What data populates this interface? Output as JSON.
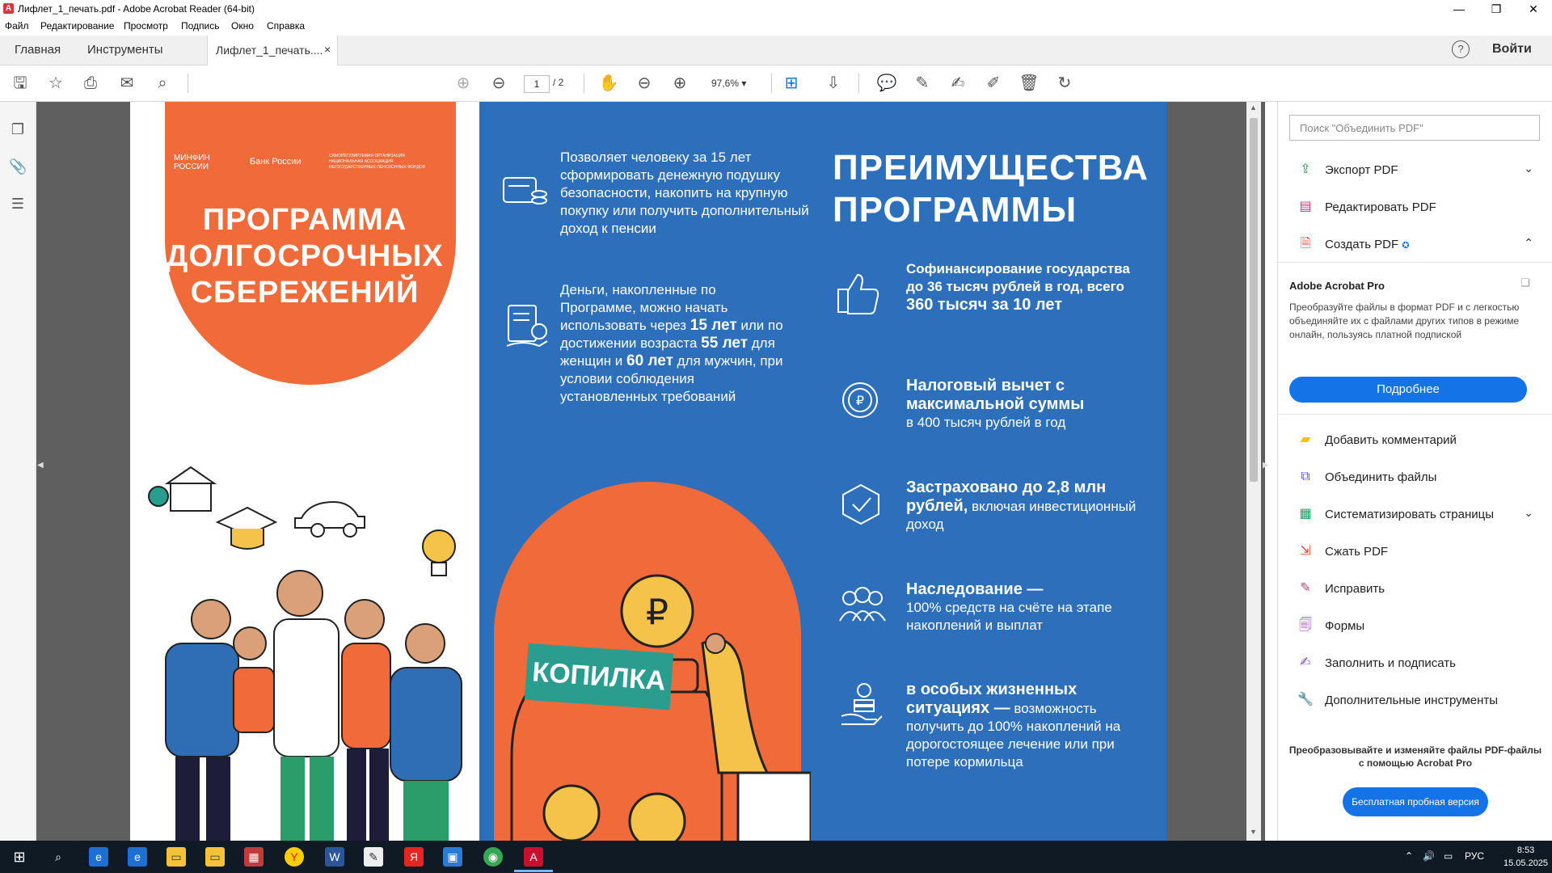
{
  "window": {
    "title": "Лифлет_1_печать.pdf - Adobe Acrobat Reader (64-bit)"
  },
  "menu": [
    "Файл",
    "Редактирование",
    "Просмотр",
    "Подпись",
    "Окно",
    "Справка"
  ],
  "tabs": {
    "home": "Главная",
    "tools": "Инструменты",
    "doc": "Лифлет_1_печать....",
    "close": "×",
    "login": "Войти",
    "help": "?"
  },
  "toolbar": {
    "page_current": "1",
    "page_total": "/ 2",
    "zoom": "97,6%"
  },
  "leaflet": {
    "logos": {
      "minfin": "МИНФИН РОССИИ",
      "cbr": "Банк России",
      "npf": "САМОРЕГУЛИРУЕМАЯ ОРГАНИЗАЦИЯ НАЦИОНАЛЬНАЯ АССОЦИАЦИЯ НЕГОСУДАРСТВЕННЫХ ПЕНСИОННЫХ ФОНДОВ"
    },
    "title_lines": [
      "ПРОГРАММА",
      "ДОЛГОСРОЧНЫХ",
      "СБЕРЕЖЕНИЙ"
    ],
    "block1": "Позволяет человеку за 15 лет сформировать денежную подушку безопасности, накопить на крупную покупку или получить дополнительный доход к пенсии",
    "block2": {
      "p1": "Деньги, накопленные по Программе, можно начать использовать через ",
      "b1": "15 лет",
      "p2": " или по достижении возраста ",
      "b2": "55 лет",
      "p3": " для женщин и ",
      "b3": "60 лет",
      "p4": " для мужчин, при условии соблюдения установленных требований"
    },
    "jar_label": "КОПИЛКА",
    "adv_title_lines": [
      "ПРЕИМУЩЕСТВА",
      "ПРОГРАММЫ"
    ],
    "adv1": {
      "t1": "Софинансирование государства до 36 тысяч рублей в год, всего ",
      "b": "360 тысяч за 10 лет"
    },
    "adv2": {
      "b": "Налоговый вычет с максимальной суммы",
      "t": "в 400 тысяч рублей в год"
    },
    "adv3": {
      "b": "Застраховано до 2,8 млн рублей,",
      "t": " включая инвестиционный доход"
    },
    "adv4": {
      "b": "Наследование —",
      "t": "100% средств на счёте на этапе накоплений и выплат"
    },
    "adv5": {
      "b": "в особых жизненных ситуациях —",
      "t": " возможность получить до 100% накоплений на дорогостоящее лечение или при потере кормильца"
    }
  },
  "right_panel": {
    "search_placeholder": "Поиск \"Объединить PDF\"",
    "items_top": [
      {
        "label": "Экспорт PDF",
        "icon": "export-pdf-icon",
        "color": "#1fa25a"
      },
      {
        "label": "Редактировать PDF",
        "icon": "edit-pdf-icon",
        "color": "#d9367a"
      },
      {
        "label": "Создать PDF",
        "icon": "create-pdf-icon",
        "color": "#e4443a"
      }
    ],
    "promo_title": "Adobe Acrobat Pro",
    "promo_desc": "Преобразуйте файлы в формат PDF и с легкостью объединяйте их с файлами других типов в режиме онлайн, пользуясь платной подпиской",
    "promo_button": "Подробнее",
    "items_bottom": [
      {
        "label": "Добавить комментарий",
        "color": "#f4c20d"
      },
      {
        "label": "Объединить файлы",
        "color": "#5a4fcf"
      },
      {
        "label": "Систематизировать страницы",
        "color": "#1fa25a"
      },
      {
        "label": "Сжать PDF",
        "color": "#e4443a"
      },
      {
        "label": "Исправить",
        "color": "#d9367a"
      },
      {
        "label": "Формы",
        "color": "#9b3bc4"
      },
      {
        "label": "Заполнить и подписать",
        "color": "#7a4fb5"
      },
      {
        "label": "Дополнительные инструменты",
        "color": "#444444"
      }
    ],
    "bottom_promo_lines": [
      "Преобразовывайте и изменяйте файлы PDF-файлы",
      "с помощью Acrobat Pro"
    ],
    "trial_button": "Бесплатная пробная версия"
  },
  "taskbar": {
    "lang": "РУС",
    "time": "8:53",
    "date": "15.05.2025"
  }
}
